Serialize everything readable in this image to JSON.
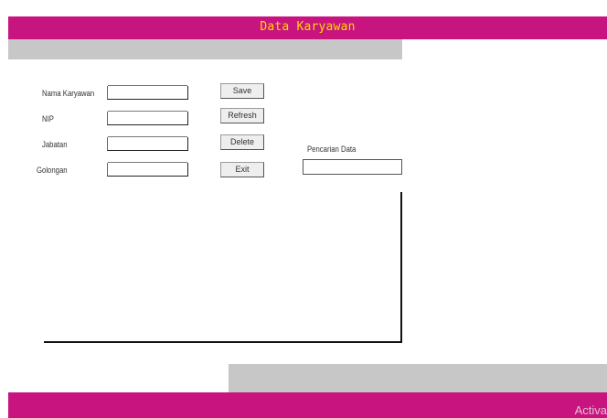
{
  "header": {
    "title": "Data Karyawan"
  },
  "form": {
    "fields": [
      {
        "label": "Nama Karyawan"
      },
      {
        "label": "NIP"
      },
      {
        "label": "Jabatan"
      },
      {
        "label": "Golongan"
      }
    ]
  },
  "buttons": {
    "save": "Save",
    "refresh": "Refresh",
    "delete": "Delete",
    "exit": "Exit"
  },
  "search": {
    "label": "Pencarian Data"
  },
  "watermark": "Activa",
  "colors": {
    "accent": "#c8147f",
    "title": "#ffd700",
    "bar": "#c7c7c7"
  }
}
